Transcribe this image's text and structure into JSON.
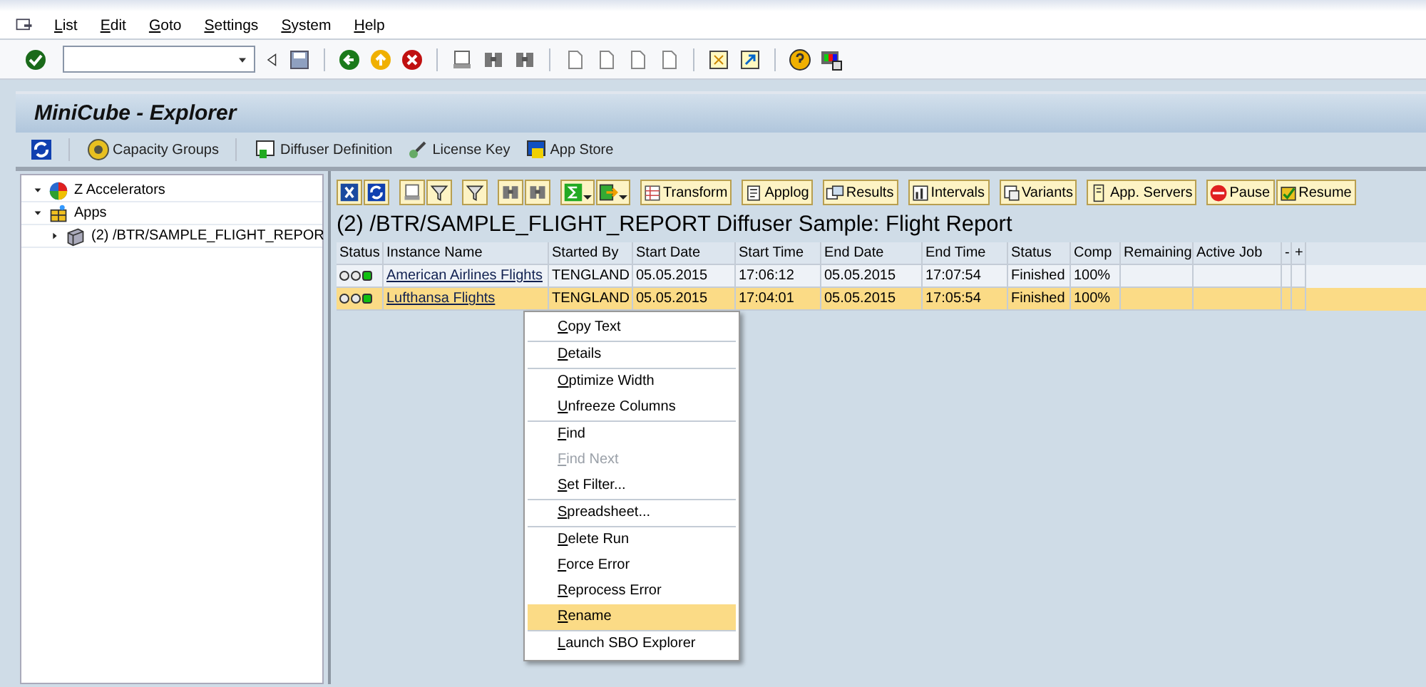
{
  "menu_bar": [
    "List",
    "Edit",
    "Goto",
    "Settings",
    "System",
    "Help"
  ],
  "window": {
    "title": "MiniCube - Explorer"
  },
  "app_toolbar": [
    {
      "kind": "refresh"
    },
    {
      "kind": "text",
      "label": "Capacity Groups"
    },
    {
      "kind": "text",
      "label": "Diffuser Definition"
    },
    {
      "kind": "text",
      "label": "License Key"
    },
    {
      "kind": "text",
      "label": "App Store"
    }
  ],
  "tree": [
    {
      "label": "Z Accelerators",
      "expanded": true
    },
    {
      "label": "Apps",
      "expanded": true,
      "children": [
        {
          "label": "(2) /BTR/SAMPLE_FLIGHT_REPOR",
          "expanded": false
        }
      ]
    }
  ],
  "alv_toolbar": [
    "Transform",
    "Applog",
    "Results",
    "Intervals",
    "Variants",
    "App. Servers",
    "Pause",
    "Resume"
  ],
  "report_title": "(2) /BTR/SAMPLE_FLIGHT_REPORT Diffuser Sample: Flight Report",
  "table": {
    "columns": [
      "Status",
      "Instance Name",
      "Started By",
      "Start Date",
      "Start Time",
      "End Date",
      "End Time",
      "Status",
      "Comp",
      "Remaining",
      "Active Job",
      "-",
      "+"
    ],
    "rows": [
      {
        "selected": false,
        "color": "#10c010",
        "instance_name": "American Airlines Flights",
        "started_by": "TENGLAND",
        "start_date": "05.05.2015",
        "start_time": "17:06:12",
        "end_date": "05.05.2015",
        "end_time": "17:07:54",
        "status": "Finished",
        "comp": "100%"
      },
      {
        "selected": true,
        "color": "#10c010",
        "instance_name": "Lufthansa Flights",
        "started_by": "TENGLAND",
        "start_date": "05.05.2015",
        "start_time": "17:04:01",
        "end_date": "05.05.2015",
        "end_time": "17:05:54",
        "status": "Finished",
        "comp": "100%"
      }
    ]
  },
  "context_menu": {
    "groups": [
      [
        {
          "label": "Copy Text",
          "disabled": false,
          "selected": false
        }
      ],
      [
        {
          "label": "Details",
          "disabled": false,
          "selected": false
        }
      ],
      [
        {
          "label": "Optimize Width",
          "disabled": false,
          "selected": false
        },
        {
          "label": "Unfreeze Columns",
          "disabled": false,
          "selected": false
        }
      ],
      [
        {
          "label": "Find",
          "disabled": false,
          "selected": false
        },
        {
          "label": "Find Next",
          "disabled": true,
          "selected": false
        },
        {
          "label": "Set Filter...",
          "disabled": false,
          "selected": false
        }
      ],
      [
        {
          "label": "Spreadsheet...",
          "disabled": false,
          "selected": false
        }
      ],
      [
        {
          "label": "Delete Run",
          "disabled": false,
          "selected": false
        },
        {
          "label": "Force Error",
          "disabled": false,
          "selected": false
        },
        {
          "label": "Reprocess Error",
          "disabled": false,
          "selected": false
        },
        {
          "label": "Rename",
          "disabled": false,
          "selected": true
        }
      ],
      [
        {
          "label": "Launch SBO Explorer",
          "disabled": false,
          "selected": false
        }
      ]
    ]
  }
}
